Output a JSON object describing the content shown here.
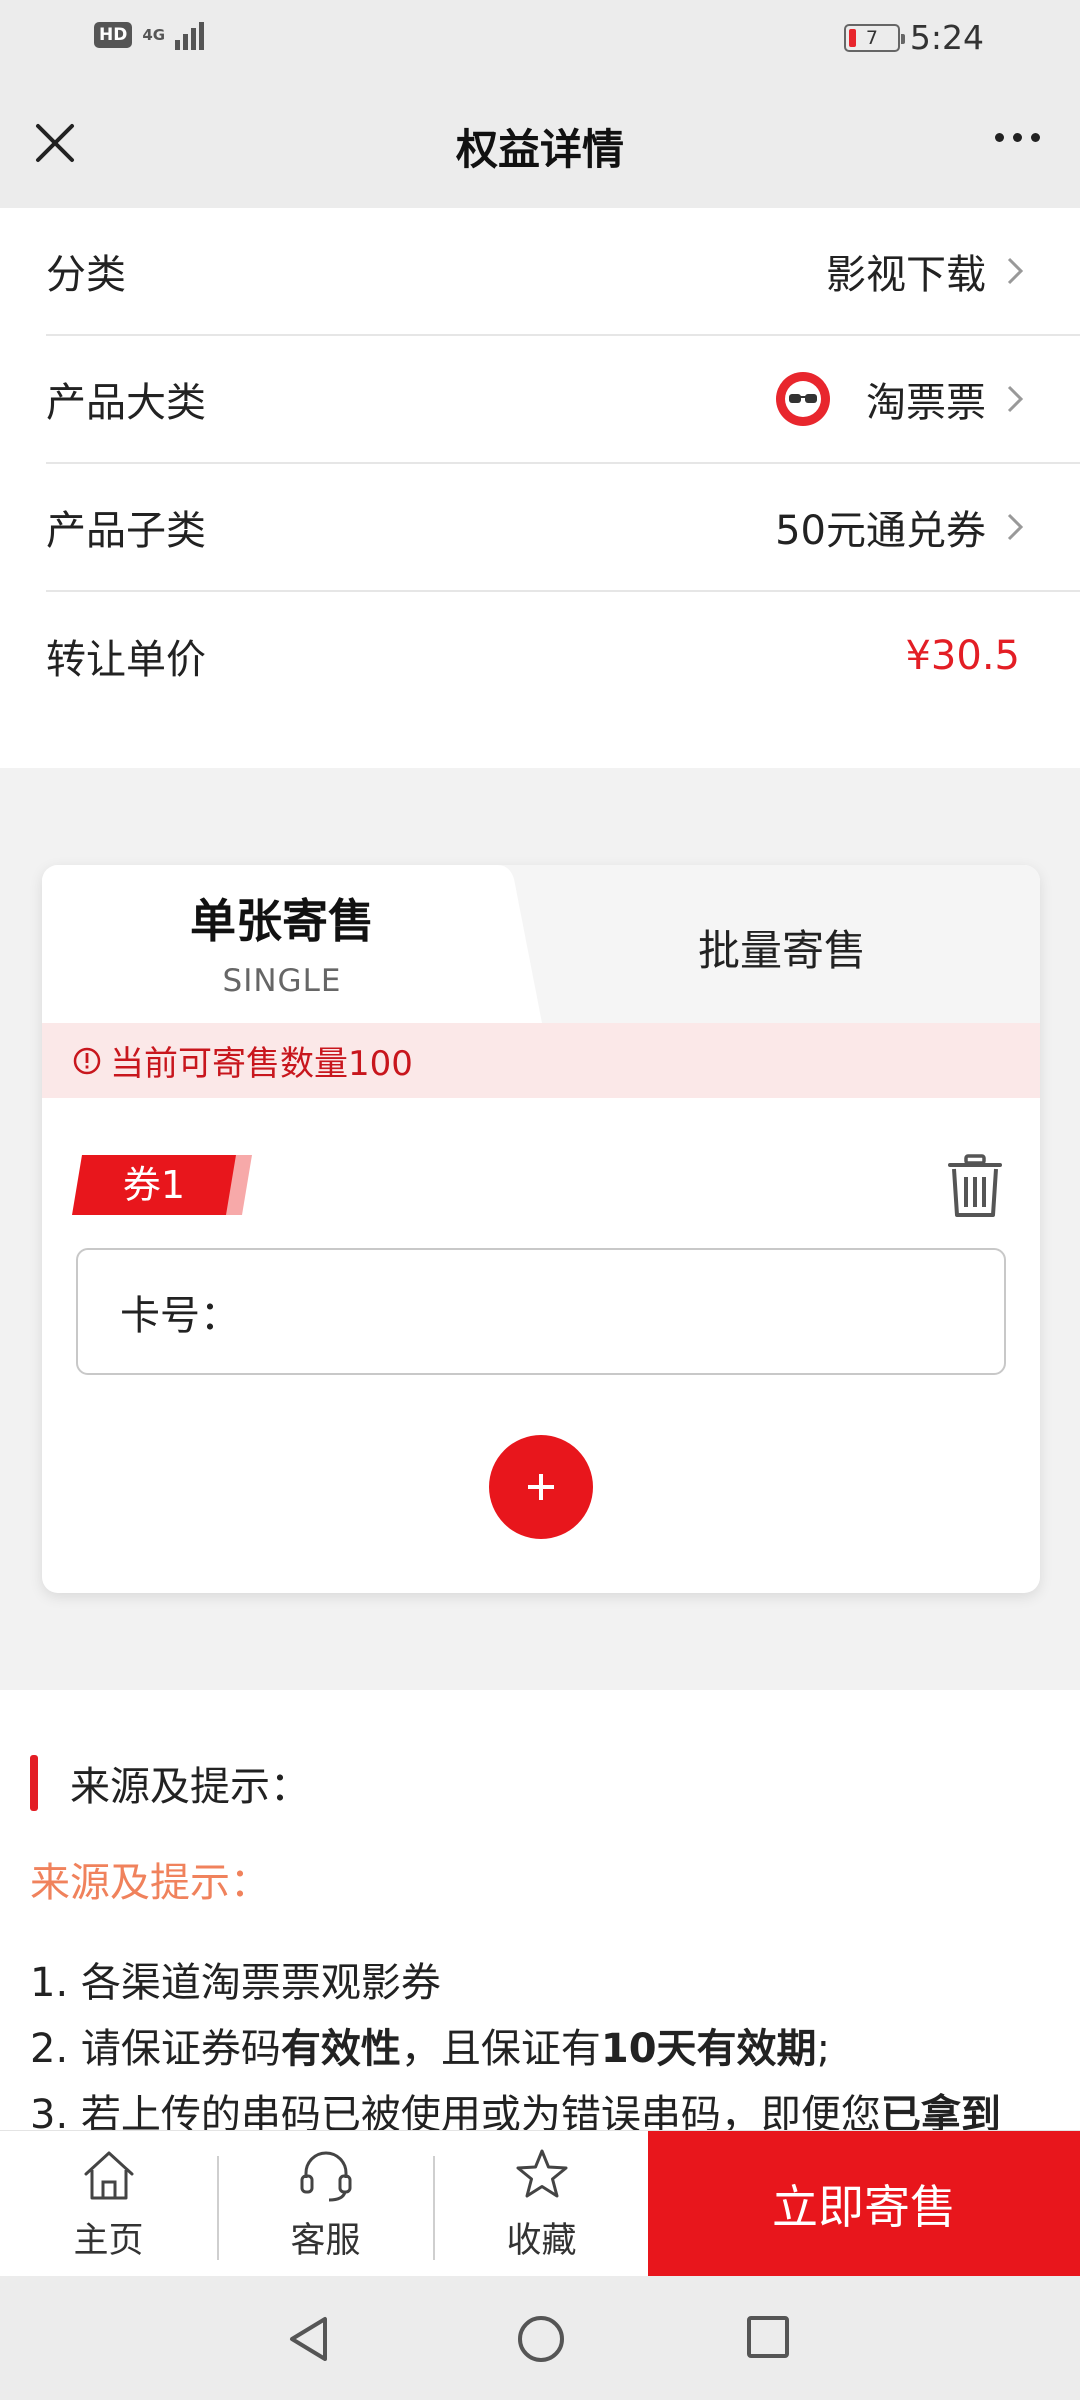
{
  "status_bar": {
    "hd": "HD",
    "network": "4G",
    "battery": "7",
    "time": "5:24"
  },
  "header": {
    "title": "权益详情"
  },
  "info_rows": [
    {
      "label": "分类",
      "value": "影视下载"
    },
    {
      "label": "产品大类",
      "value": "淘票票",
      "icon": "taopiaopiao-logo-icon"
    },
    {
      "label": "产品子类",
      "value": "50元通兑券"
    },
    {
      "label": "转让单价",
      "value": "¥30.5"
    }
  ],
  "tabs": {
    "single": {
      "label": "单张寄售",
      "sublabel": "SINGLE"
    },
    "batch": {
      "label": "批量寄售"
    }
  },
  "notice": "当前可寄售数量100",
  "coupon": {
    "tag": "券1",
    "card_label": "卡号：",
    "card_value": ""
  },
  "tips": {
    "heading": "来源及提示：",
    "subheading": "来源及提示：",
    "line1": "1. 各渠道淘票票观影券",
    "line2_a": "2. 请保证券码",
    "line2_b": "有效性",
    "line2_c": "，且保证有",
    "line2_d": "10天有效期",
    "line2_e": ";",
    "line3_a": "3. 若上传的串码已被使用或为错误串码，即便您",
    "line3_b": "已拿到"
  },
  "bottom_bar": {
    "home": "主页",
    "service": "客服",
    "favorite": "收藏",
    "sell": "立即寄售"
  },
  "colors": {
    "accent": "#e8161c",
    "price": "#e31e25",
    "tip_orange": "#f0825c",
    "notice_bg": "#fbe8e8"
  }
}
